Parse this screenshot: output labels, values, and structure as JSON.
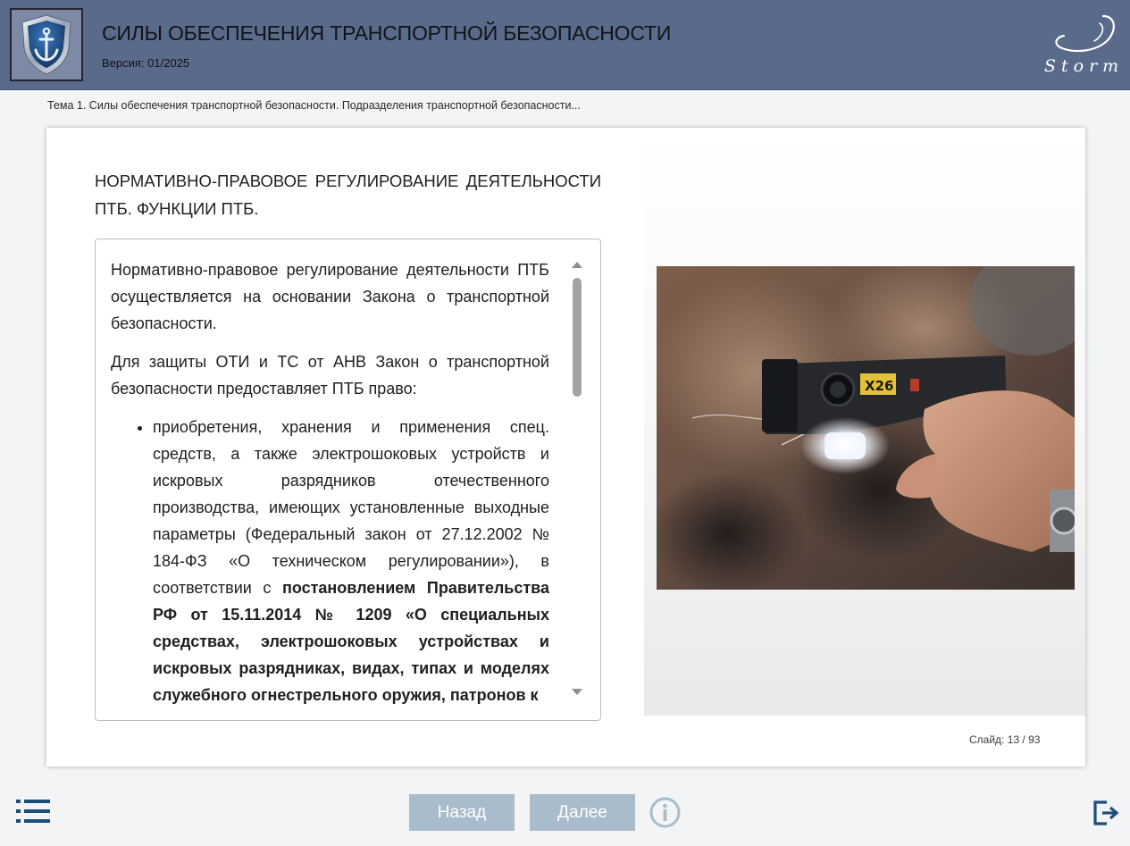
{
  "header": {
    "course_title": "СИЛЫ ОБЕСПЕЧЕНИЯ ТРАНСПОРТНОЙ БЕЗОПАСНОСТИ",
    "version": "Версия: 01/2025",
    "brand_name": "Storm",
    "colors": {
      "header_bg": "#5a6a8a",
      "shield_blue": "#1c4e8c"
    }
  },
  "breadcrumb": "Тема 1. Силы обеспечения транспортной безопасности. Подразделения транспортной безопасности...",
  "slide": {
    "heading": "НОРМАТИВНО-ПРАВОВОЕ РЕГУЛИРОВАНИЕ ДЕЯТЕЛЬНОСТИ ПТБ. ФУНКЦИИ ПТБ.",
    "paragraph_1": "Нормативно-правовое регулирование деятельности ПТБ осуществляется на основании Закона о транспортной безопасности.",
    "paragraph_2": "Для защиты ОТИ и ТС от АНВ Закон о транспортной безопасности предоставляет ПТБ право:",
    "bullet_1_text": "приобретения, хранения и применения спец. средств, а также электрошоковых устройств и искровых разрядников отечественного производства, имеющих установленные выходные параметры (Федеральный закон от 27.12.2002 № 184-ФЗ «О техническом регулировании»), в соответствии с ",
    "bullet_1_bold": "постановлением Правительства РФ от 15.11.2014 № 1209 «О специальных средствах, электрошоковых устройствах и искровых разрядниках, видах, типах и моделях служебного огнестрельного оружия, патронов к",
    "photo_label": "X26",
    "counter_label": "Слайд:",
    "counter_value": "13 / 93"
  },
  "nav": {
    "back_label": "Назад",
    "next_label": "Далее",
    "button_color": "#a9bccb",
    "icons": [
      "menu-list-icon",
      "info-icon",
      "exit-icon"
    ]
  }
}
